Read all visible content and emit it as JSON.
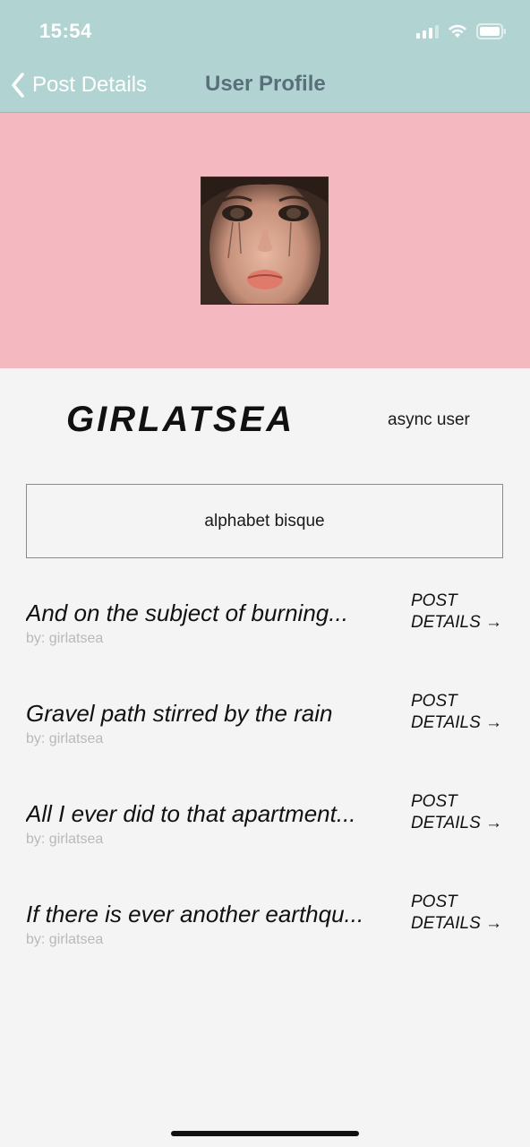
{
  "status_bar": {
    "time": "15:54"
  },
  "nav": {
    "back_label": "Post Details",
    "title": "User Profile"
  },
  "profile": {
    "username": "GIRLATSEA",
    "role": "async user",
    "bio": "alphabet bisque"
  },
  "posts": [
    {
      "title": "And on the subject of burning...",
      "author": "by: girlatsea",
      "link_line1": "POST",
      "link_line2": "DETAILS →"
    },
    {
      "title": "Gravel path stirred by the rain",
      "author": "by: girlatsea",
      "link_line1": "POST",
      "link_line2": "DETAILS →"
    },
    {
      "title": "All I ever did to that apartment...",
      "author": "by: girlatsea",
      "link_line1": "POST",
      "link_line2": "DETAILS →"
    },
    {
      "title": "If there is ever another earthqu...",
      "author": "by: girlatsea",
      "link_line1": "POST",
      "link_line2": "DETAILS →"
    }
  ],
  "colors": {
    "header_bg": "#b1d4d3",
    "cover_bg": "#f4b8c0",
    "page_bg": "#f4f4f4",
    "nav_title": "#59707a"
  },
  "icons": [
    "chevron-left-icon",
    "cellular-signal-icon",
    "wifi-icon",
    "battery-icon",
    "avatar-photo"
  ]
}
